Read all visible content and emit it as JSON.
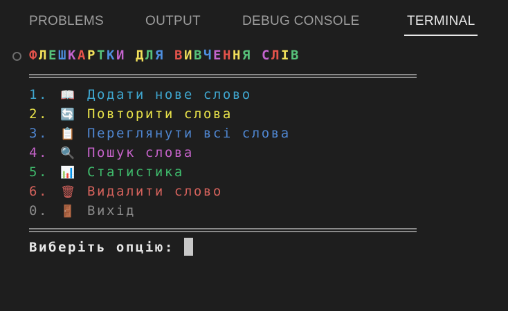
{
  "panel_tabs": [
    {
      "label": "PROBLEMS",
      "active": false
    },
    {
      "label": "OUTPUT",
      "active": false
    },
    {
      "label": "DEBUG CONSOLE",
      "active": false
    },
    {
      "label": "TERMINAL",
      "active": true
    }
  ],
  "terminal": {
    "title": "ФЛЕШКАРТКИ ДЛЯ ВИВЧЕННЯ СЛІВ",
    "title_colors": [
      "#e5534b",
      "#f1e05a",
      "#57c27a",
      "#4e8fe0",
      "#c464cf"
    ],
    "menu": [
      {
        "num": "1.",
        "icon": "book-icon",
        "glyph": "📖",
        "label": "Додати нове слово",
        "color": "#3fa6cf"
      },
      {
        "num": "2.",
        "icon": "refresh-icon",
        "glyph": "🔄",
        "label": "Повторити слова",
        "color": "#e9e34a"
      },
      {
        "num": "3.",
        "icon": "clipboard-icon",
        "glyph": "📋",
        "label": "Переглянути всі слова",
        "color": "#4f86d0"
      },
      {
        "num": "4.",
        "icon": "magnifier-icon",
        "glyph": "🔍",
        "label": "Пошук слова",
        "color": "#c462c8"
      },
      {
        "num": "5.",
        "icon": "bar-chart-icon",
        "glyph": "📊",
        "label": "Статистика",
        "color": "#3fbb6c"
      },
      {
        "num": "6.",
        "icon": "trash-icon",
        "glyph": "🗑",
        "label": "Видалити слово",
        "color": "#d5625c"
      },
      {
        "num": "0.",
        "icon": "door-icon",
        "glyph": "🚪",
        "label": "Вихід",
        "color": "#8a8a8a"
      }
    ],
    "prompt": "Виберіть опцію: "
  }
}
